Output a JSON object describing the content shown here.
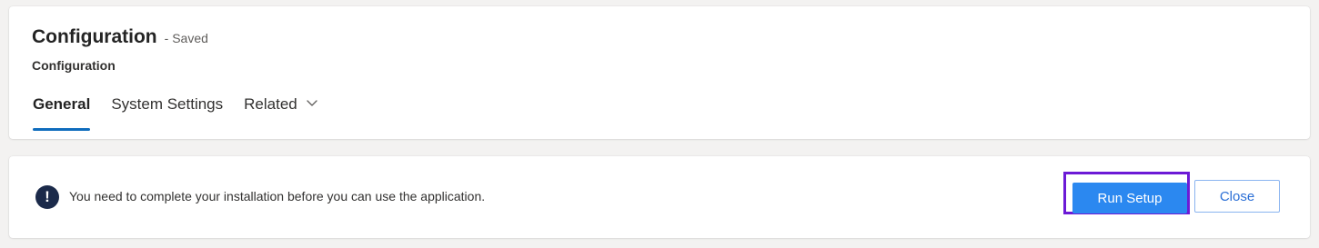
{
  "header": {
    "title": "Configuration",
    "status": "- Saved",
    "entity_type": "Configuration"
  },
  "tabs": [
    {
      "label": "General",
      "active": true
    },
    {
      "label": "System Settings",
      "active": false
    },
    {
      "label": "Related",
      "active": false,
      "has_dropdown": true
    }
  ],
  "notice": {
    "icon": "exclamation-icon",
    "icon_glyph": "!",
    "message": "You need to complete your installation before you can use the application.",
    "primary_button": "Run Setup",
    "secondary_button": "Close"
  },
  "colors": {
    "accent": "#0f6cbd",
    "primary_button": "#2b88f0",
    "highlight_border": "#6c1ad6",
    "notice_icon_bg": "#1b2a4a"
  }
}
